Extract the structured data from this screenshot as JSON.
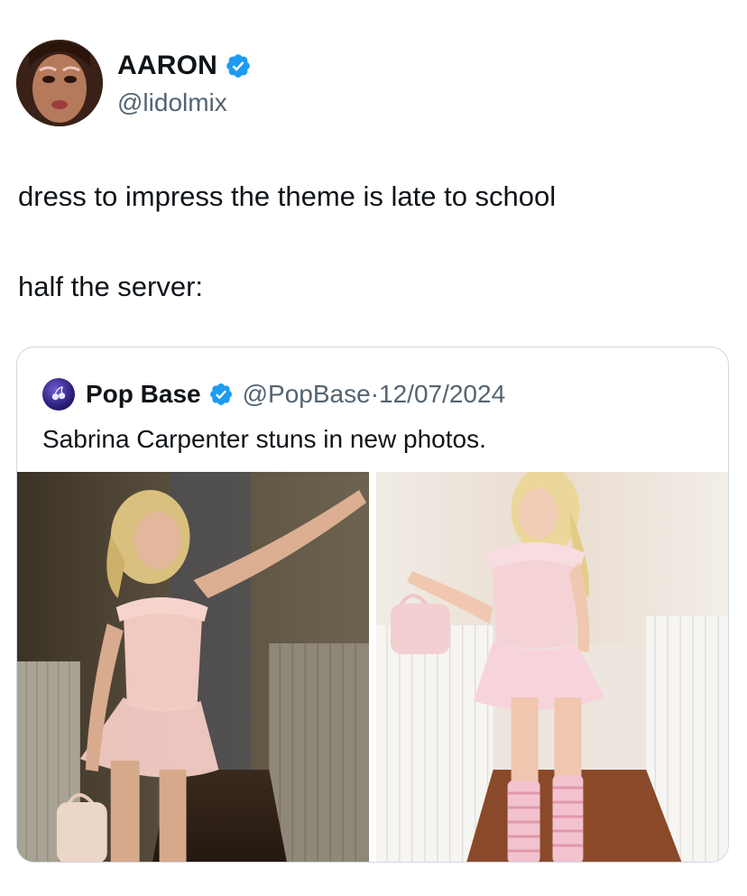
{
  "tweet": {
    "author": {
      "display_name": "AARON",
      "handle": "@lidolmix",
      "verified_icon": "verified-badge-icon"
    },
    "text_lines": [
      "dress to impress the theme is late to school",
      "half the server:"
    ]
  },
  "quote": {
    "author": {
      "display_name": "Pop Base",
      "handle": "@PopBase",
      "date": "12/07/2024",
      "verified_icon": "verified-badge-icon"
    },
    "text": "Sabrina Carpenter stuns in new photos.",
    "photos": [
      {
        "name": "photo-1"
      },
      {
        "name": "photo-2"
      }
    ]
  },
  "colors": {
    "verified_blue": "#1d9bf0",
    "secondary_text": "#536471",
    "border": "#cfd9de"
  }
}
